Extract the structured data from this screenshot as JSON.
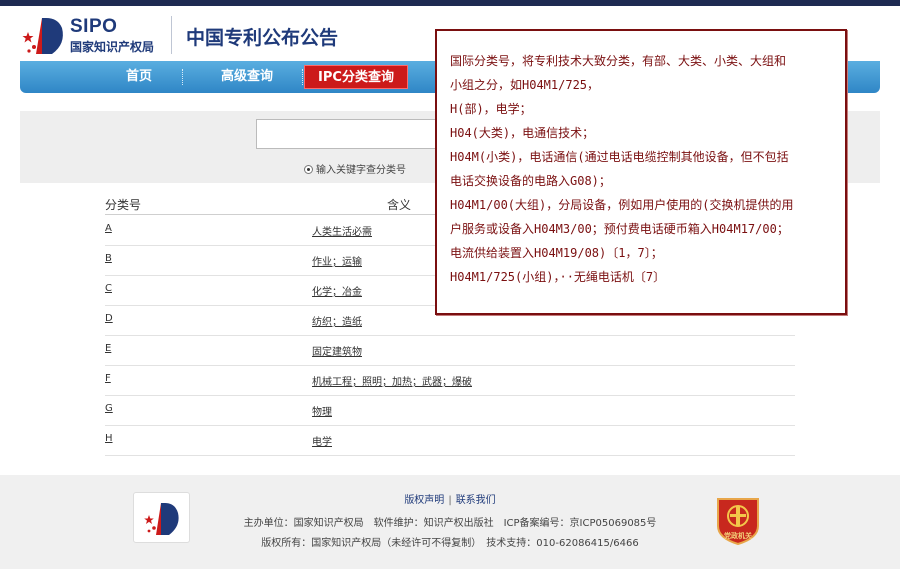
{
  "header": {
    "logo_text": "SIPO",
    "logo_subtitle": "国家知识产权局",
    "title": "中国专利公布公告"
  },
  "nav": {
    "items": [
      {
        "label": "首页"
      },
      {
        "label": "高级查询"
      },
      {
        "label": "IPC分类查询",
        "active": true
      }
    ]
  },
  "search": {
    "query_value": "",
    "radio_keyword_label": "输入关键字查分类号",
    "radio_keyword_selected": true
  },
  "table": {
    "col_code": "分类号",
    "col_meaning": "含义",
    "rows": [
      {
        "code": "A",
        "meaning": "人类生活必需"
      },
      {
        "code": "B",
        "meaning": "作业；运输"
      },
      {
        "code": "C",
        "meaning": "化学；冶金"
      },
      {
        "code": "D",
        "meaning": "纺织；造纸"
      },
      {
        "code": "E",
        "meaning": "固定建筑物"
      },
      {
        "code": "F",
        "meaning": "机械工程；照明；加热；武器；爆破"
      },
      {
        "code": "G",
        "meaning": "物理"
      },
      {
        "code": "H",
        "meaning": "电学"
      }
    ]
  },
  "footer": {
    "link_copyright": "版权声明",
    "link_separator": "|",
    "link_contact": "联系我们",
    "line1": "主办单位：国家知识产权局　软件维护：知识产权出版社　ICP备案编号：京ICP05069085号",
    "line2": "版权所有：国家知识产权局（未经许可不得复制）　技术支持：010-62086415/6466",
    "badge_text": "党政机关"
  },
  "popup": {
    "lines": [
      "国际分类号，将专利技术大致分类，有部、大类、小类、大组和",
      "小组之分，如H04M1/725，",
      "H(部)，电学；",
      "H04(大类)，电通信技术；",
      "H04M(小类)，电话通信(通过电话电缆控制其他设备，但不包括",
      "电话交换设备的电路入G08)；",
      "H04M1/00(大组)，分局设备，例如用户使用的(交换机提供的用",
      "户服务或设备入H04M3/00；预付费电话硬币箱入H04M17/00；",
      "电流供给装置入H04M19/08)〔1，7〕；",
      "H04M1/725(小组)，··无绳电话机〔7〕"
    ]
  },
  "colors": {
    "brand_navy": "#1f3a7a",
    "nav_blue": "#2f86c6",
    "active_red": "#cc1a1a",
    "popup_border": "#7a0f10"
  }
}
